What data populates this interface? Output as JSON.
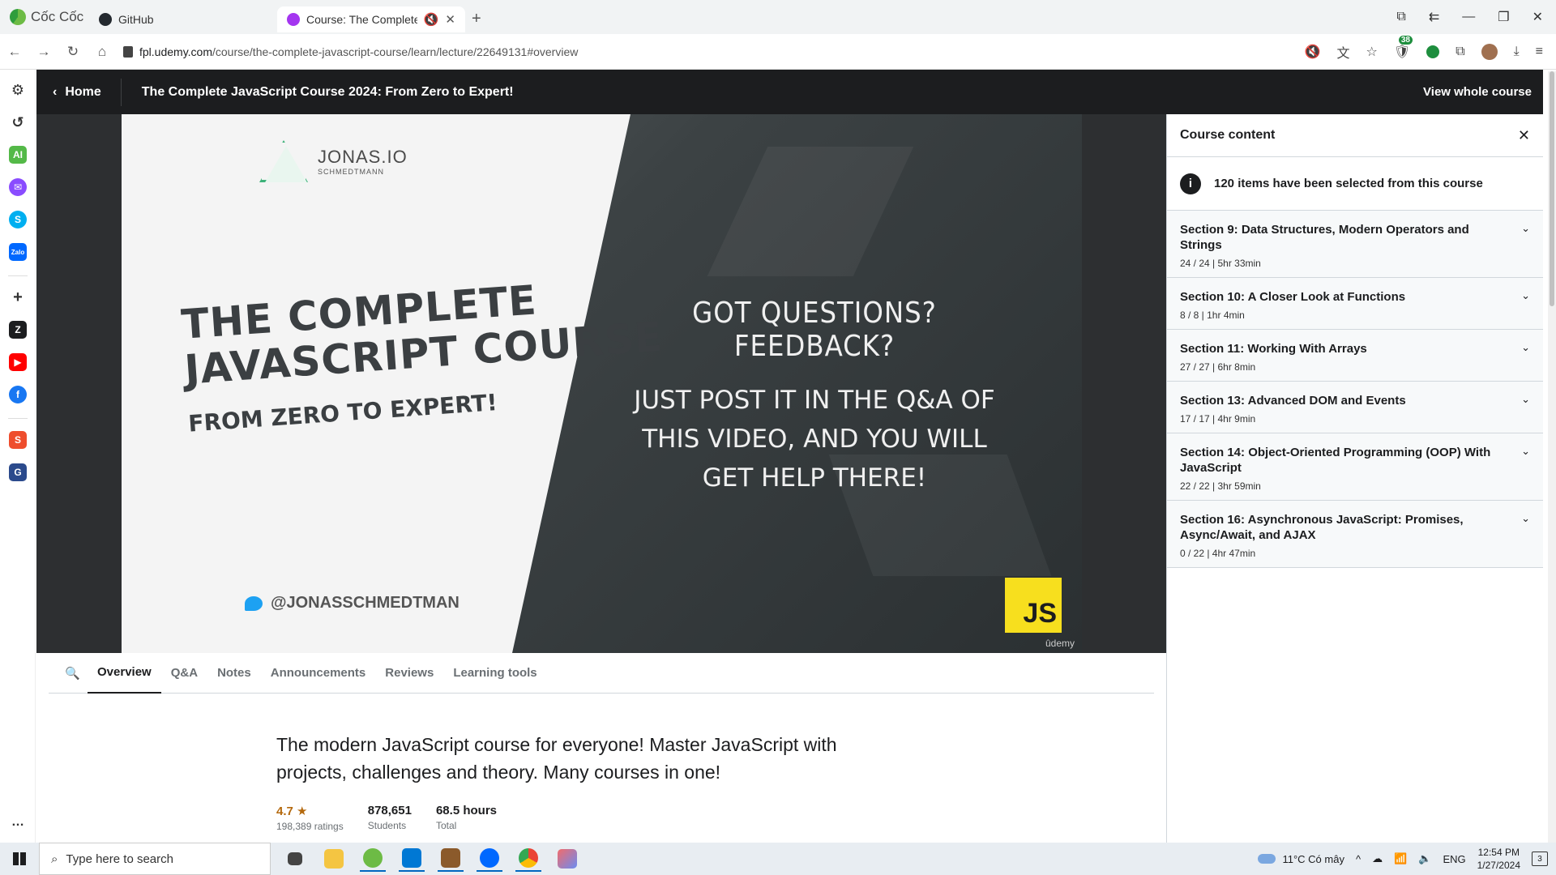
{
  "browser": {
    "brand": "Cốc Cốc",
    "tabs": [
      {
        "title": "GitHub",
        "active": false
      },
      {
        "title": "Course: The Complete Ja",
        "active": true
      }
    ],
    "url_host": "fpl.udemy.com",
    "url_path": "/course/the-complete-javascript-course/learn/lecture/22649131#overview",
    "extension_badge": "38"
  },
  "header": {
    "home_label": "Home",
    "course_title": "The Complete JavaScript Course 2024: From Zero to Expert!",
    "view_whole_label": "View whole course"
  },
  "slide": {
    "brand_main": "JONAS.IO",
    "brand_sub": "SCHMEDTMANN",
    "title_line1": "THE COMPLETE",
    "title_line2": "JAVASCRIPT COURSE",
    "subtitle": "FROM ZERO TO EXPERT!",
    "twitter": "@JONASSCHMEDTMAN",
    "question": "GOT QUESTIONS? FEEDBACK?",
    "answer": "JUST POST IT IN THE Q&A OF THIS VIDEO, AND YOU WILL GET HELP THERE!",
    "js_badge": "JS",
    "watermark": "ûdemy"
  },
  "subtabs": [
    "Overview",
    "Q&A",
    "Notes",
    "Announcements",
    "Reviews",
    "Learning tools"
  ],
  "overview": {
    "headline": "The modern JavaScript course for everyone! Master JavaScript with projects, challenges and theory. Many courses in one!",
    "rating": "4.7",
    "rating_label": "198,389 ratings",
    "students": "878,651",
    "students_label": "Students",
    "hours": "68.5 hours",
    "hours_label": "Total"
  },
  "sidebar": {
    "title": "Course content",
    "info": "120 items have been selected from this course",
    "sections": [
      {
        "title": "Section 9: Data Structures, Modern Operators and Strings",
        "meta": "24 / 24 | 5hr 33min"
      },
      {
        "title": "Section 10: A Closer Look at Functions",
        "meta": "8 / 8 | 1hr 4min"
      },
      {
        "title": "Section 11: Working With Arrays",
        "meta": "27 / 27 | 6hr 8min"
      },
      {
        "title": "Section 13: Advanced DOM and Events",
        "meta": "17 / 17 | 4hr 9min"
      },
      {
        "title": "Section 14: Object-Oriented Programming (OOP) With JavaScript",
        "meta": "22 / 22 | 3hr 59min"
      },
      {
        "title": "Section 16: Asynchronous JavaScript: Promises, Async/Await, and AJAX",
        "meta": "0 / 22 | 4hr 47min"
      }
    ]
  },
  "taskbar": {
    "search_placeholder": "Type here to search",
    "weather": "11°C  Có mây",
    "lang": "ENG",
    "time": "12:54 PM",
    "date": "1/27/2024",
    "notifications": "3"
  },
  "colors": {
    "header_bg": "#1c1d1f",
    "accent_star": "#b4690e",
    "js_yellow": "#f7df1e"
  }
}
